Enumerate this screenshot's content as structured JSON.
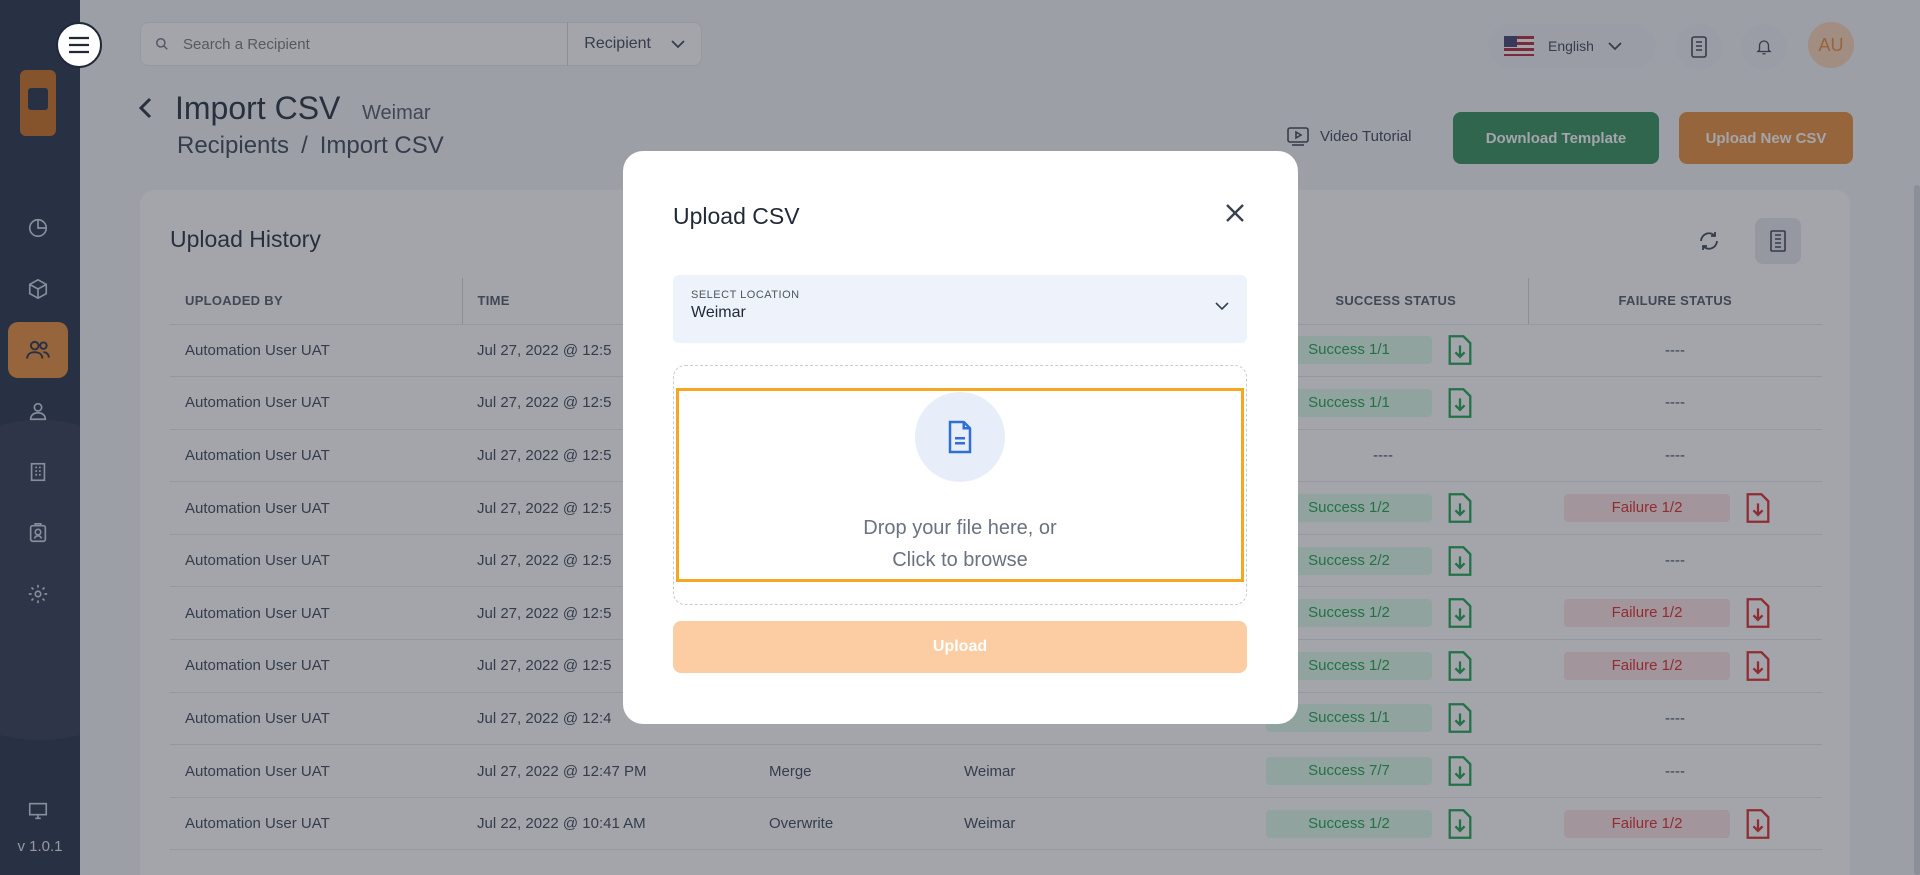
{
  "sidebar": {
    "version": "v 1.0.1",
    "items": [
      "dashboard-icon",
      "package-icon",
      "users-icon",
      "user-icon",
      "building-icon",
      "badge-icon",
      "gear-icon"
    ],
    "active_index": 2
  },
  "topbar": {
    "search_placeholder": "Search a Recipient",
    "search_type": "Recipient",
    "language": "English",
    "avatar_initials": "AU"
  },
  "header": {
    "title": "Import CSV",
    "location": "Weimar",
    "breadcrumb": [
      "Recipients",
      "/",
      "Import CSV"
    ],
    "video_tutorial": "Video Tutorial",
    "download_template": "Download Template",
    "upload_new_csv": "Upload New CSV"
  },
  "history": {
    "title": "Upload History",
    "columns": [
      "UPLOADED BY",
      "TIME",
      "",
      "",
      "SUCCESS STATUS",
      "FAILURE STATUS"
    ],
    "rows": [
      {
        "user": "Automation User UAT",
        "time": "Jul 27, 2022 @ 12:5",
        "mode": "",
        "location": "",
        "success": "Success 1/1",
        "failure": "----"
      },
      {
        "user": "Automation User UAT",
        "time": "Jul 27, 2022 @ 12:5",
        "mode": "",
        "location": "",
        "success": "Success 1/1",
        "failure": "----"
      },
      {
        "user": "Automation User UAT",
        "time": "Jul 27, 2022 @ 12:5",
        "mode": "",
        "location": "",
        "success": "----",
        "failure": "----"
      },
      {
        "user": "Automation User UAT",
        "time": "Jul 27, 2022 @ 12:5",
        "mode": "",
        "location": "",
        "success": "Success 1/2",
        "failure": "Failure 1/2"
      },
      {
        "user": "Automation User UAT",
        "time": "Jul 27, 2022 @ 12:5",
        "mode": "",
        "location": "",
        "success": "Success 2/2",
        "failure": "----"
      },
      {
        "user": "Automation User UAT",
        "time": "Jul 27, 2022 @ 12:5",
        "mode": "",
        "location": "",
        "success": "Success 1/2",
        "failure": "Failure 1/2"
      },
      {
        "user": "Automation User UAT",
        "time": "Jul 27, 2022 @ 12:5",
        "mode": "",
        "location": "",
        "success": "Success 1/2",
        "failure": "Failure 1/2"
      },
      {
        "user": "Automation User UAT",
        "time": "Jul 27, 2022 @ 12:4",
        "mode": "",
        "location": "",
        "success": "Success 1/1",
        "failure": "----"
      },
      {
        "user": "Automation User UAT",
        "time": "Jul 27, 2022 @ 12:47 PM",
        "mode": "Merge",
        "location": "Weimar",
        "success": "Success 7/7",
        "failure": "----"
      },
      {
        "user": "Automation User UAT",
        "time": "Jul 22, 2022 @ 10:41 AM",
        "mode": "Overwrite",
        "location": "Weimar",
        "success": "Success 1/2",
        "failure": "Failure 1/2"
      }
    ]
  },
  "modal": {
    "title": "Upload CSV",
    "select_label": "SELECT LOCATION",
    "select_value": "Weimar",
    "drop_line1": "Drop your file here, or",
    "drop_line2": "Click to browse",
    "upload_label": "Upload"
  },
  "colors": {
    "sidebar": "#1f2a44",
    "accent_orange": "#e98b34",
    "green": "#2e8b57",
    "upload_disabled": "#fccda3",
    "highlight": "#f5a623"
  }
}
